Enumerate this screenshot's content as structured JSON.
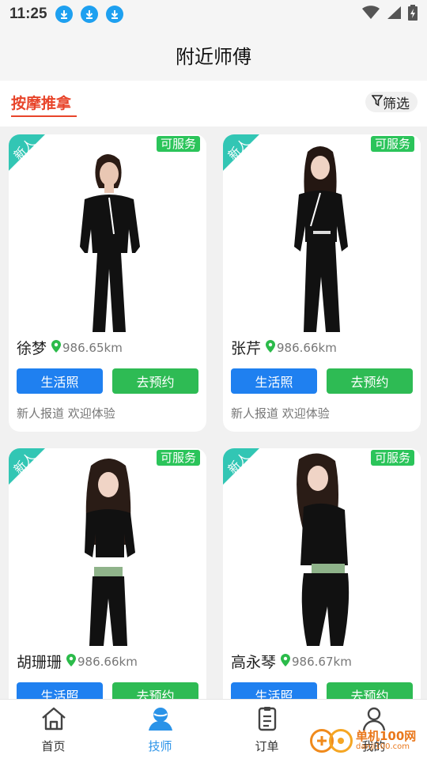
{
  "status_bar": {
    "time": "11:25"
  },
  "header": {
    "title": "附近师傅"
  },
  "tabbar": {
    "active_tab": "按摩推拿",
    "filter_label": "筛选"
  },
  "technicians": [
    {
      "name": "徐梦",
      "distance": "986.65km",
      "badge": "新人",
      "status": "可服务",
      "life_photo_label": "生活照",
      "book_label": "去预约",
      "desc": "新人报道 欢迎体验"
    },
    {
      "name": "张芹",
      "distance": "986.66km",
      "badge": "新人",
      "status": "可服务",
      "life_photo_label": "生活照",
      "book_label": "去预约",
      "desc": "新人报道 欢迎体验"
    },
    {
      "name": "胡珊珊",
      "distance": "986.66km",
      "badge": "新人",
      "status": "可服务",
      "life_photo_label": "生活照",
      "book_label": "去预约",
      "desc": ""
    },
    {
      "name": "高永琴",
      "distance": "986.67km",
      "badge": "新人",
      "status": "可服务",
      "life_photo_label": "生活照",
      "book_label": "去预约",
      "desc": ""
    }
  ],
  "bottom_nav": [
    {
      "label": "首页",
      "icon": "home-icon"
    },
    {
      "label": "技师",
      "icon": "technician-icon"
    },
    {
      "label": "订单",
      "icon": "order-icon"
    },
    {
      "label": "我的",
      "icon": "profile-icon"
    }
  ],
  "watermark": {
    "main": "单机100网",
    "sub": "danji100.com"
  },
  "colors": {
    "accent": "#e8442a",
    "primary": "#1f80f0",
    "success": "#2ebb54",
    "ribbon": "#32c6b4",
    "nav_active": "#2a93e8"
  }
}
